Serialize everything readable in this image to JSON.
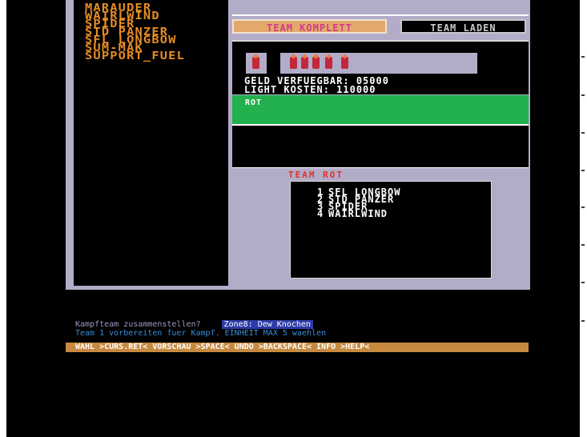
{
  "unit_list": [
    "MARAUDER",
    "WAIRLWIND",
    "SPIDER",
    "STD PANZER",
    "SFL LONGBOW",
    "SUM-MAK",
    "SUPPORT_FUEL"
  ],
  "tabs": {
    "team_complete": "TEAM KOMPLETT",
    "team_load": "TEAM LADEN"
  },
  "stats": {
    "money_label": "GELD VERFUEGBAR:",
    "money_value": "05000",
    "cost_label": "LIGHT KOSTEN:",
    "cost_value": "110000"
  },
  "team_bar_label": "ROT",
  "team_panel": {
    "title": "TEAM ROT",
    "members": [
      {
        "num": "1",
        "name": "SFL LONGBOW"
      },
      {
        "num": "2",
        "name": "STD PANZER"
      },
      {
        "num": "3",
        "name": "SPIDER"
      },
      {
        "num": "4",
        "name": "WAIRLWIND"
      }
    ]
  },
  "messages": {
    "line1": "Kampfteam zusammenstellen?",
    "line1_highlight": "Zone8: Dew Knochen",
    "line2": "Team 1 vorbereiten fuer Kampf. EINHEIT MAX 5 waehlen",
    "help_bar": "WAHL >CURS.RET< VORSCHAU >SPACE< UNDO >BACKSPACE< INFO >HELP<"
  },
  "colors": {
    "panel": "#b3acc8",
    "accent_orange": "#e58d24",
    "team_green": "#22b14c",
    "help_bar": "#c78940"
  }
}
